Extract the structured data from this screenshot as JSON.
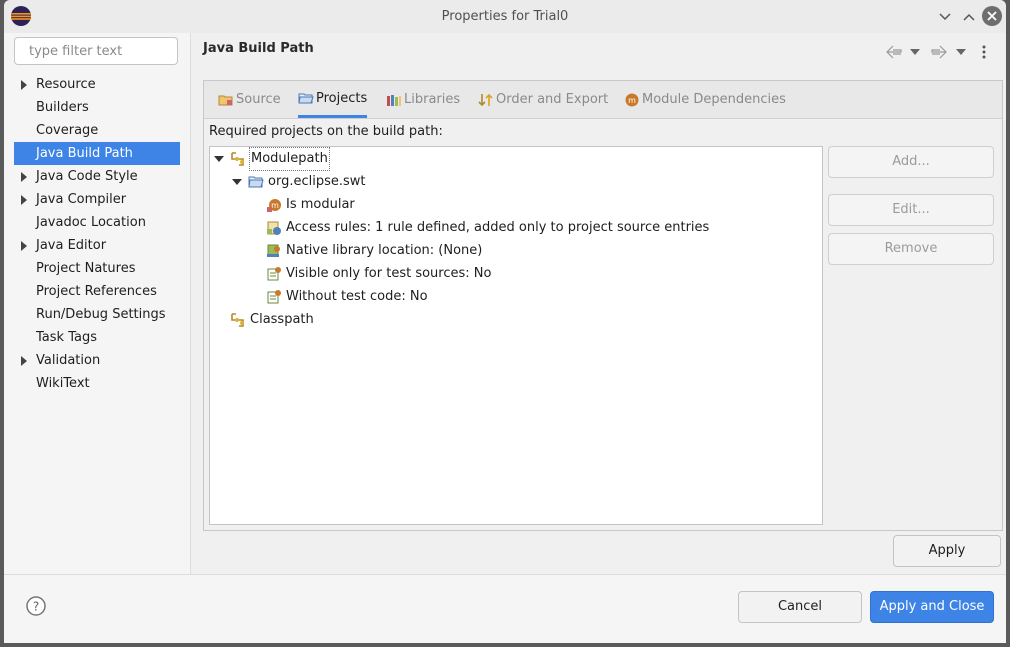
{
  "window": {
    "title": "Properties for Trial0"
  },
  "sidebar": {
    "filter_placeholder": "type filter text",
    "items": [
      {
        "label": "Resource",
        "expandable": true
      },
      {
        "label": "Builders",
        "expandable": false
      },
      {
        "label": "Coverage",
        "expandable": false
      },
      {
        "label": "Java Build Path",
        "expandable": false,
        "selected": true
      },
      {
        "label": "Java Code Style",
        "expandable": true
      },
      {
        "label": "Java Compiler",
        "expandable": true
      },
      {
        "label": "Javadoc Location",
        "expandable": false
      },
      {
        "label": "Java Editor",
        "expandable": true
      },
      {
        "label": "Project Natures",
        "expandable": false
      },
      {
        "label": "Project References",
        "expandable": false
      },
      {
        "label": "Run/Debug Settings",
        "expandable": false
      },
      {
        "label": "Task Tags",
        "expandable": false
      },
      {
        "label": "Validation",
        "expandable": true
      },
      {
        "label": "WikiText",
        "expandable": false
      }
    ]
  },
  "main": {
    "title": "Java Build Path",
    "tabs": [
      {
        "label": "Source",
        "icon": "source-folder-icon"
      },
      {
        "label": "Projects",
        "icon": "projects-folder-icon",
        "active": true
      },
      {
        "label": "Libraries",
        "icon": "libraries-icon"
      },
      {
        "label": "Order and Export",
        "icon": "order-export-icon"
      },
      {
        "label": "Module Dependencies",
        "icon": "module-icon"
      }
    ],
    "required_label": "Required projects on the build path:",
    "tree": {
      "modulepath": "Modulepath",
      "project": "org.eclipse.swt",
      "attrs": [
        "Is modular",
        "Access rules: 1 rule defined, added only to project source entries",
        "Native library location: (None)",
        "Visible only for test sources: No",
        "Without test code: No"
      ],
      "classpath": "Classpath"
    },
    "buttons": {
      "add": "Add...",
      "edit": "Edit...",
      "remove": "Remove"
    }
  },
  "actions": {
    "apply": "Apply",
    "cancel": "Cancel",
    "apply_close": "Apply and Close"
  },
  "colors": {
    "accent": "#3d84e6",
    "selection": "#3d84e6"
  }
}
